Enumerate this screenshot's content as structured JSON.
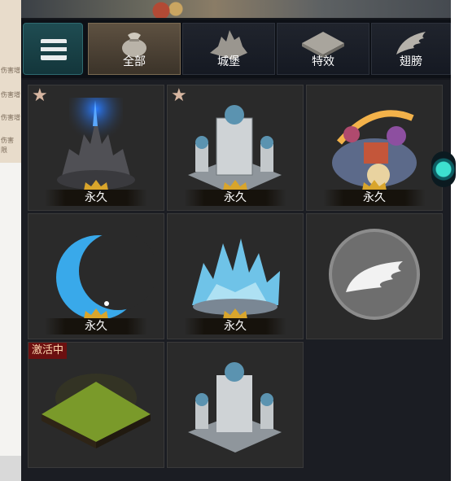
{
  "background_page": {
    "labels": [
      "伤害增",
      "伤害增",
      "伤害增",
      "伤害",
      "限"
    ]
  },
  "tabs": [
    {
      "label": "全部",
      "icon": "bag-icon",
      "active": true
    },
    {
      "label": "城堡",
      "icon": "castle-icon",
      "active": false
    },
    {
      "label": "特效",
      "icon": "tile-icon",
      "active": false
    },
    {
      "label": "翅膀",
      "icon": "wing-icon",
      "active": false
    }
  ],
  "items": [
    {
      "name": "dark-castle",
      "favorite": true,
      "duration": "永久",
      "badge": ""
    },
    {
      "name": "white-palace",
      "favorite": true,
      "duration": "永久",
      "badge": ""
    },
    {
      "name": "spring-festival-isle",
      "favorite": false,
      "duration": "永久",
      "badge": ""
    },
    {
      "name": "crescent-moon",
      "favorite": false,
      "duration": "永久",
      "badge": ""
    },
    {
      "name": "ice-crystal-castle",
      "favorite": false,
      "duration": "永久",
      "badge": ""
    },
    {
      "name": "white-wing",
      "favorite": false,
      "duration": "",
      "badge": ""
    },
    {
      "name": "grass-tile",
      "favorite": false,
      "duration": "",
      "badge": "激活中"
    },
    {
      "name": "white-palace-2",
      "favorite": false,
      "duration": "",
      "badge": ""
    }
  ],
  "colors": {
    "panel_bg": "#15171c",
    "cell_bg": "#2a2a2a",
    "active_tab": "#5e5141",
    "star": "#d7b6a1",
    "active_badge": "#6b1010"
  }
}
